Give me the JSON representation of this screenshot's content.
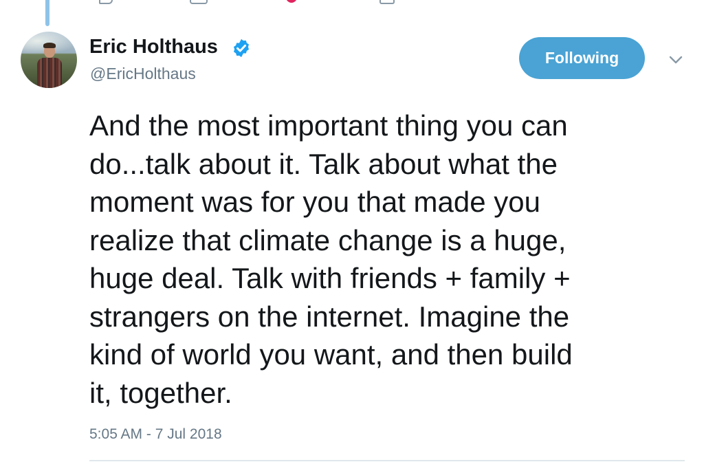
{
  "colors": {
    "accent": "#4aa3d4",
    "thread_line": "#8ec3e9",
    "text_primary": "#14171a",
    "text_secondary": "#657786",
    "verified": "#1da1f2",
    "like": "#e0245e"
  },
  "thread": {
    "previous_actions": [
      "reply-icon",
      "retweet-icon",
      "like-icon",
      "direct-message-icon"
    ]
  },
  "author": {
    "display_name": "Eric Holthaus",
    "handle": "@EricHolthaus",
    "verified": true,
    "avatar_icon": "profile-photo"
  },
  "actions": {
    "follow_label": "Following",
    "more_icon": "chevron-down-icon"
  },
  "tweet": {
    "lines": [
      "And the most important thing you can",
      "do...talk about it. Talk about what the",
      "moment was for you that made you",
      "realize that climate change is a huge,",
      "huge deal. Talk with friends + family +",
      "strangers on the internet. Imagine the",
      "kind of world you want, and then build",
      "it, together."
    ],
    "timestamp": "5:05 AM - 7 Jul 2018"
  }
}
